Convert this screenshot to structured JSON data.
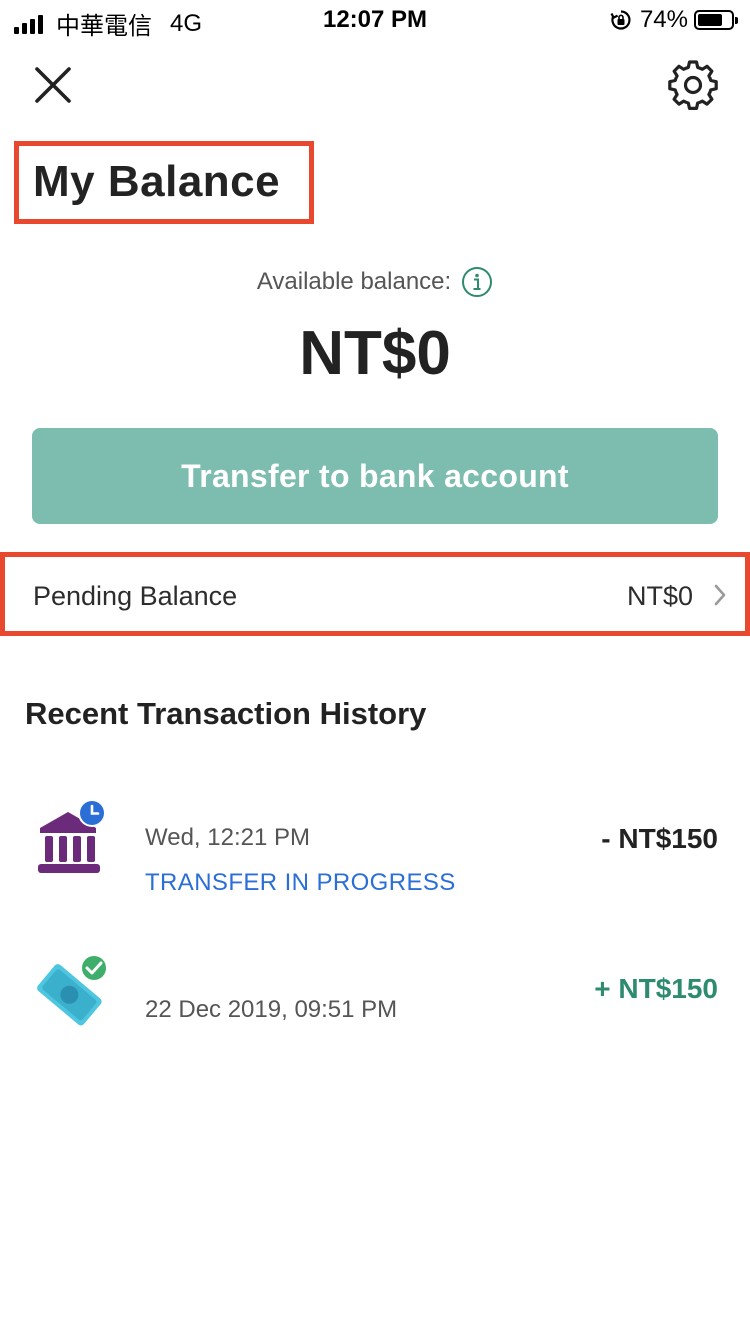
{
  "status_bar": {
    "carrier": "中華電信",
    "network": "4G",
    "time": "12:07 PM",
    "battery": "74%",
    "battery_level": 0.74
  },
  "header": {
    "close_icon": "close-icon",
    "settings_icon": "gear-icon"
  },
  "page": {
    "title": "My Balance"
  },
  "balance": {
    "available_label": "Available balance:",
    "amount": "NT$0",
    "transfer_label": "Transfer to bank account"
  },
  "pending": {
    "label": "Pending Balance",
    "value": "NT$0"
  },
  "history": {
    "title": "Recent Transaction History",
    "items": [
      {
        "icon": "bank-clock-icon",
        "date": "Wed, 12:21 PM",
        "status": "TRANSFER IN PROGRESS",
        "amount": "- NT$150"
      },
      {
        "icon": "cash-check-icon",
        "date": "22 Dec 2019, 09:51 PM",
        "status": "",
        "amount": "+ NT$150"
      }
    ]
  },
  "colors": {
    "accent_red": "#e8482d",
    "button_teal": "#7cbdaf",
    "positive_green": "#2e8b70",
    "link_blue": "#2b6fd6",
    "bank_purple": "#6b2a7a"
  }
}
